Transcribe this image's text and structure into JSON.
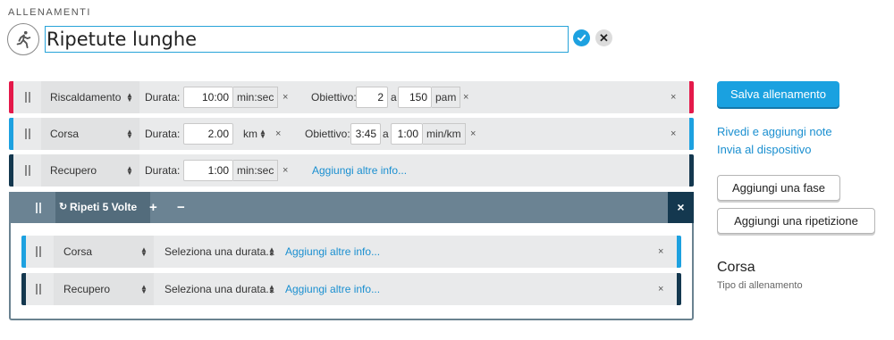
{
  "header": {
    "section_label": "ALLENAMENTI",
    "title_value": "Ripetute lunghe",
    "workout_icon": "runner-icon",
    "confirm_icon": "check-icon",
    "cancel_icon": "close-icon"
  },
  "colors": {
    "warmup": "#e4194a",
    "run": "#1da1e0",
    "recovery": "#14384f",
    "repeat_bar": "#6b8393",
    "primary_button": "#1aa1e0"
  },
  "steps": [
    {
      "type": "Riscaldamento",
      "duration_label": "Durata:",
      "duration_value": "10:00",
      "duration_unit": "min:sec",
      "target_label": "Obiettivo:",
      "target_from": "2",
      "target_sep": "a",
      "target_to": "150",
      "target_unit": "pam"
    },
    {
      "type": "Corsa",
      "duration_label": "Durata:",
      "duration_value": "2.00",
      "duration_unit": "km",
      "target_label": "Obiettivo:",
      "target_from": "3:45",
      "target_sep": "a",
      "target_to": "1:00",
      "target_unit": "min/km"
    },
    {
      "type": "Recupero",
      "duration_label": "Durata:",
      "duration_value": "1:00",
      "duration_unit": "min:sec",
      "add_info": "Aggiungi altre info..."
    }
  ],
  "repeat": {
    "label": "Ripeti 5 Volte",
    "plus": "+",
    "minus": "−",
    "close": "×",
    "steps": [
      {
        "type": "Corsa",
        "duration_placeholder": "Seleziona una durata...",
        "add_info": "Aggiungi altre info..."
      },
      {
        "type": "Recupero",
        "duration_placeholder": "Seleziona una durata...",
        "add_info": "Aggiungi altre info..."
      }
    ]
  },
  "sidebar": {
    "save_label": "Salva allenamento",
    "notes_link": "Rivedi e aggiungi note",
    "send_link": "Invia al dispositivo",
    "add_step_label": "Aggiungi una fase",
    "add_repeat_label": "Aggiungi una ripetizione",
    "workout_type": "Corsa",
    "workout_type_caption": "Tipo di allenamento"
  },
  "remove_glyph": "×"
}
